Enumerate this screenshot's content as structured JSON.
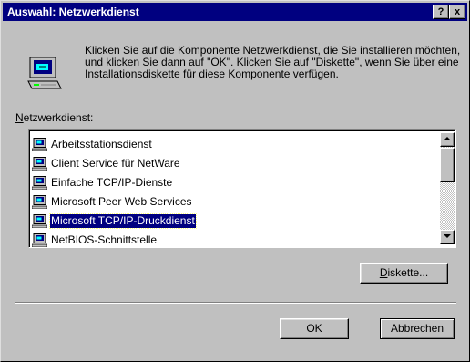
{
  "dialog": {
    "title": "Auswahl: Netzwerkdienst",
    "help_label": "?",
    "close_label": "x"
  },
  "instruction": "Klicken Sie auf die Komponente Netzwerkdienst, die Sie installieren möchten, und klicken Sie dann auf \"OK\".  Klicken Sie auf \"Diskette\", wenn Sie über eine Installationsdiskette für diese Komponente verfügen.",
  "list": {
    "label_mnemonic": "N",
    "label_rest": "etzwerkdienst:",
    "items": [
      {
        "label": "Arbeitsstationsdienst",
        "selected": false
      },
      {
        "label": "Client Service für NetWare",
        "selected": false
      },
      {
        "label": "Einfache TCP/IP-Dienste",
        "selected": false
      },
      {
        "label": "Microsoft Peer Web Services",
        "selected": false
      },
      {
        "label": "Microsoft TCP/IP-Druckdienst",
        "selected": true
      },
      {
        "label": "NetBIOS-Schnittstelle",
        "selected": false
      }
    ]
  },
  "buttons": {
    "diskette_mnemonic": "D",
    "diskette_rest": "iskette...",
    "ok": "OK",
    "cancel": "Abbrechen"
  },
  "colors": {
    "titlebar": "#000080",
    "face": "#c0c0c0",
    "selection": "#000080"
  }
}
